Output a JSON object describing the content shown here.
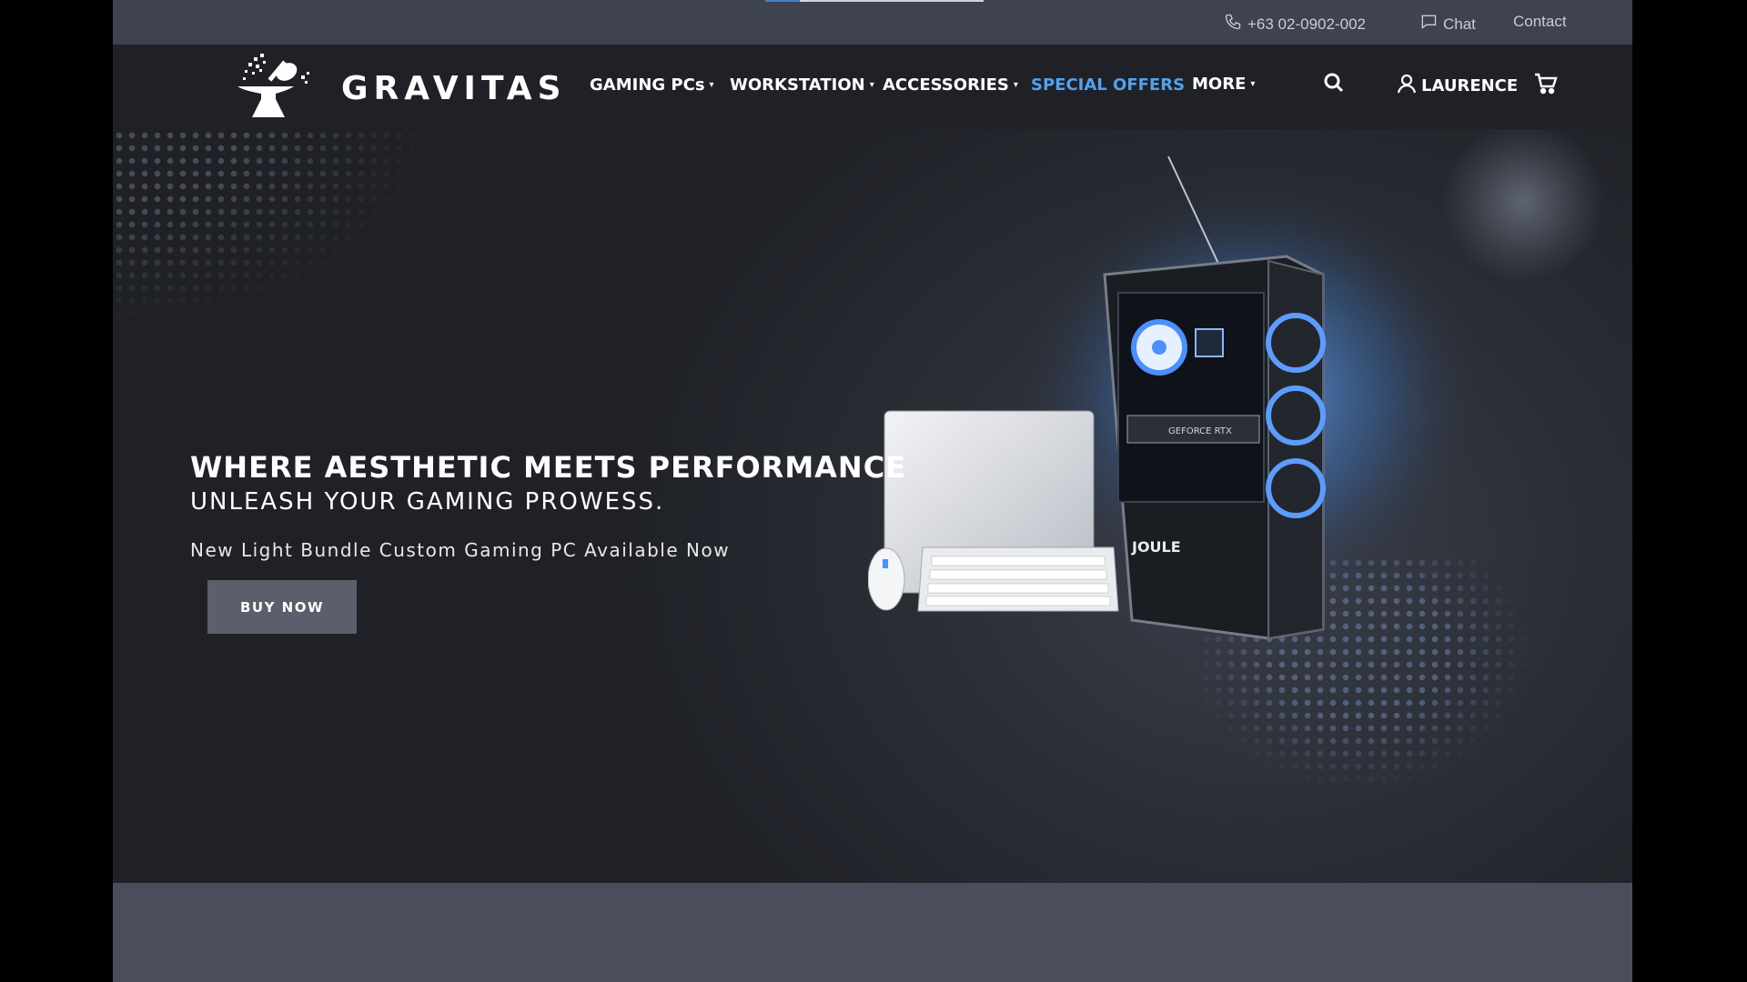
{
  "topbar": {
    "progress_fraction": 0.16,
    "phone": "+63 02-0902-002",
    "chat": "Chat",
    "contact": "Contact"
  },
  "brand": {
    "name": "GRAVITAS"
  },
  "nav": {
    "items": [
      {
        "label": "GAMING PCs",
        "caret": "▾"
      },
      {
        "label": "WORKSTATION",
        "caret": "▾"
      },
      {
        "label": "ACCESSORIES",
        "caret": "▾"
      },
      {
        "label": "SPECIAL OFFERS",
        "caret": ""
      },
      {
        "label": "MORE",
        "caret": "▾"
      }
    ],
    "user": "LAURENCE",
    "icons": [
      "search-icon",
      "user-icon",
      "cart-icon"
    ],
    "special_color": "#4fa3f0"
  },
  "hero": {
    "headline": "WHERE AESTHETIC MEETS PERFORMANCE",
    "subhead": "UNLEASH YOUR GAMING PROWESS.",
    "tagline": "New Light Bundle Custom Gaming PC Available Now",
    "cta": "BUY NOW",
    "product_texts": {
      "gpu": "GEFORCE RTX",
      "case_brand": "JOULE"
    }
  },
  "colors": {
    "accent": "#3b7fd4",
    "nav_bg": "#1f2127",
    "topbar_bg": "#3f4350"
  }
}
